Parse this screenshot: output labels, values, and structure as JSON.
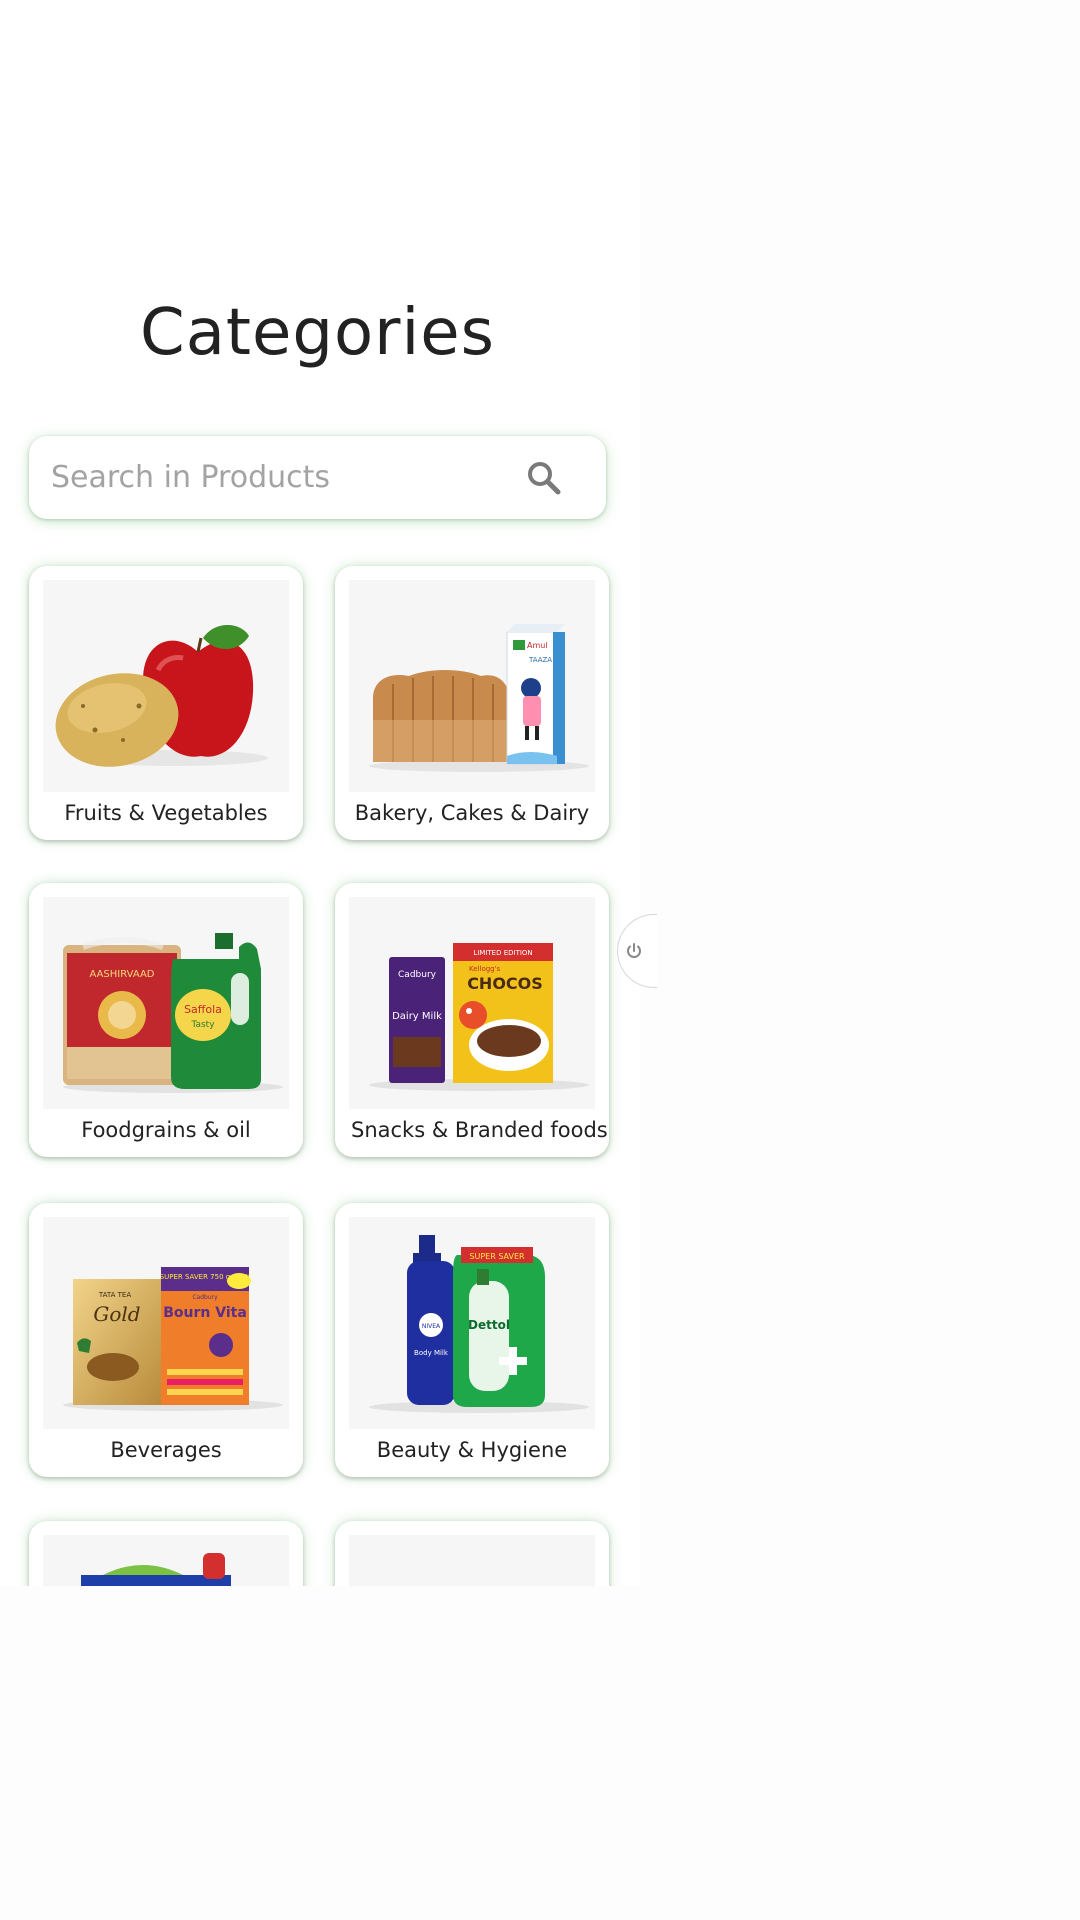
{
  "page": {
    "title": "Categories"
  },
  "search": {
    "placeholder": "Search in Products"
  },
  "categories": [
    {
      "label": "Fruits & Vegetables"
    },
    {
      "label": "Bakery, Cakes & Dairy"
    },
    {
      "label": "Foodgrains & oil"
    },
    {
      "label": "Snacks & Branded foods"
    },
    {
      "label": "Beverages"
    },
    {
      "label": "Beauty & Hygiene"
    }
  ],
  "images": {
    "bakery": {
      "milk_brand": "Amul",
      "milk_name": "TAAZA"
    },
    "foodgrains": {
      "atta_brand": "AASHIRVAAD",
      "oil_brand": "Saffola",
      "oil_variant": "Tasty"
    },
    "snacks": {
      "chocolate_maker": "Cadbury",
      "chocolate": "Dairy Milk",
      "cereal_brand": "Kellogg's",
      "cereal": "CHOCOS",
      "cereal_tag": "LIMITED EDITION"
    },
    "beverages": {
      "tea_brand": "TATA TEA",
      "tea": "Gold",
      "drink_badge": "SUPER SAVER 750 g PACK",
      "drink_maker": "Cadbury",
      "drink": "Bourn Vita"
    },
    "beauty": {
      "lotion_brand": "NIVEA",
      "lotion": "Body Milk",
      "soap_badge": "SUPER SAVER",
      "soap_brand": "Dettol"
    }
  },
  "colors": {
    "accent_glow": "#4caf50",
    "placeholder": "#a3a3a3",
    "card_bg": "#ffffff",
    "thumb_bg": "#f6f6f6"
  }
}
